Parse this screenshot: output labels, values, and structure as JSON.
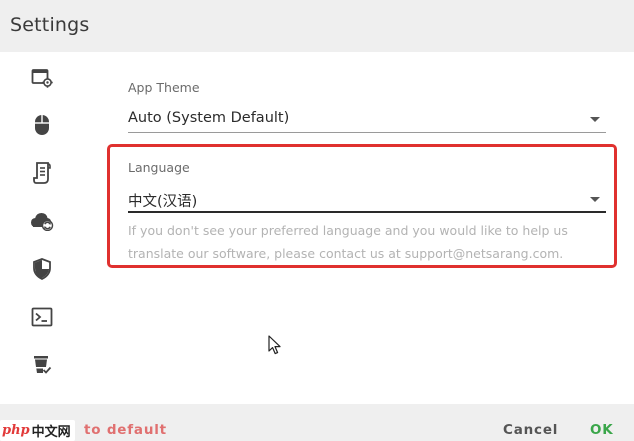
{
  "window": {
    "title": "Settings"
  },
  "sidebar": {
    "items": [
      {
        "icon": "window-settings-icon"
      },
      {
        "icon": "mouse-icon"
      },
      {
        "icon": "document-scroll-icon"
      },
      {
        "icon": "cloud-sync-icon"
      },
      {
        "icon": "shield-icon"
      },
      {
        "icon": "terminal-icon"
      },
      {
        "icon": "clear-history-icon"
      }
    ]
  },
  "theme": {
    "label": "App Theme",
    "value": "Auto (System Default)"
  },
  "language": {
    "label": "Language",
    "value": "中文(汉语)",
    "help": "If you don't see your preferred language and you would like to help us translate our software, please contact us at support@netsarang.com."
  },
  "footer": {
    "reset_label": "to default",
    "cancel_label": "Cancel",
    "ok_label": "OK"
  },
  "watermark": {
    "brand": "php",
    "cn": "中文网"
  },
  "colors": {
    "highlight": "#e0312f",
    "ok": "#3aa64a",
    "reset": "#e07070",
    "footer_bg": "#efefef"
  }
}
